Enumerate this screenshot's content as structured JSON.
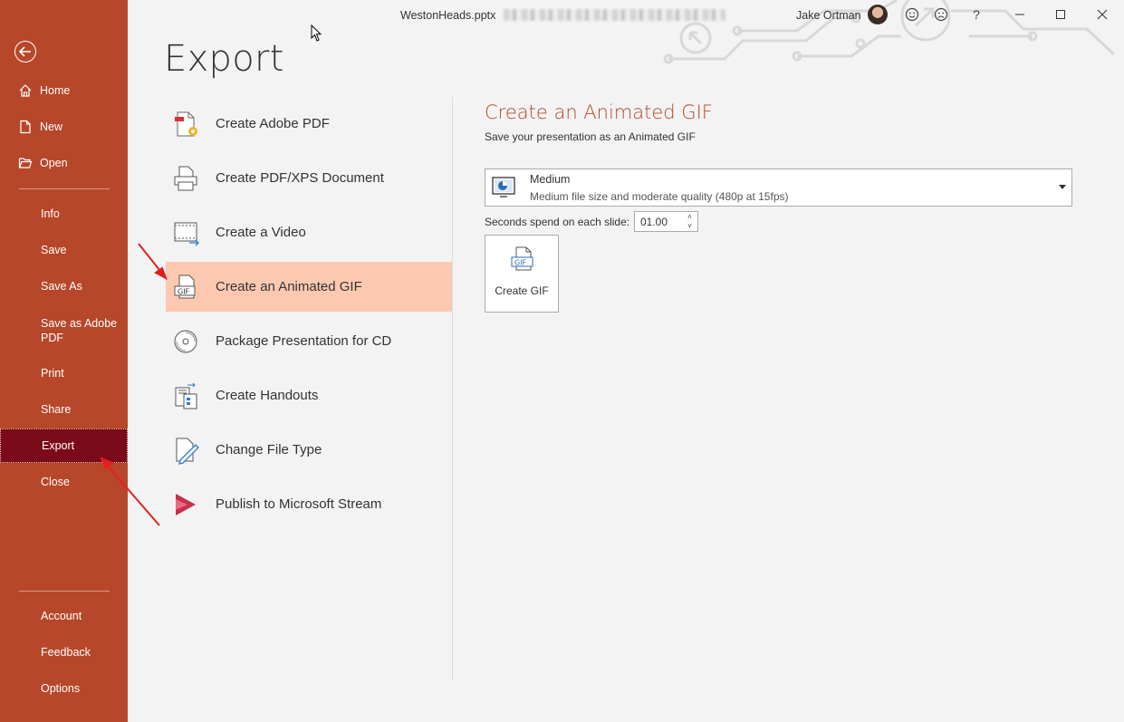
{
  "window": {
    "file_name": "WestonHeads.pptx",
    "user_name": "Jake Ortman",
    "help_label": "?"
  },
  "sidebar": {
    "items": [
      {
        "id": "home",
        "label": "Home",
        "icon": "home-icon"
      },
      {
        "id": "new",
        "label": "New",
        "icon": "new-document-icon"
      },
      {
        "id": "open",
        "label": "Open",
        "icon": "open-folder-icon"
      },
      {
        "id": "info",
        "label": "Info"
      },
      {
        "id": "save",
        "label": "Save"
      },
      {
        "id": "save-as",
        "label": "Save As"
      },
      {
        "id": "save-as-adobe-pdf",
        "label": "Save as Adobe PDF"
      },
      {
        "id": "print",
        "label": "Print"
      },
      {
        "id": "share",
        "label": "Share"
      },
      {
        "id": "export",
        "label": "Export",
        "selected": true
      },
      {
        "id": "close",
        "label": "Close"
      },
      {
        "id": "account",
        "label": "Account"
      },
      {
        "id": "feedback",
        "label": "Feedback"
      },
      {
        "id": "options",
        "label": "Options"
      }
    ],
    "bg_color": "#b7472a",
    "selected_color": "#7b0b18"
  },
  "page": {
    "title": "Export"
  },
  "export_options": [
    {
      "label": "Create Adobe PDF",
      "icon": "adobe-pdf-icon"
    },
    {
      "label": "Create PDF/XPS Document",
      "icon": "pdf-xps-icon"
    },
    {
      "label": "Create a Video",
      "icon": "video-icon"
    },
    {
      "label": "Create an Animated GIF",
      "icon": "gif-icon",
      "selected": true
    },
    {
      "label": "Package Presentation for CD",
      "icon": "cd-icon"
    },
    {
      "label": "Create Handouts",
      "icon": "handouts-icon"
    },
    {
      "label": "Change File Type",
      "icon": "change-file-type-icon"
    },
    {
      "label": "Publish to Microsoft Stream",
      "icon": "stream-icon"
    }
  ],
  "detail": {
    "title": "Create an Animated GIF",
    "subtitle": "Save your presentation as an Animated GIF",
    "quality": {
      "selected": "Medium",
      "description": "Medium file size and moderate quality (480p at 15fps)"
    },
    "seconds": {
      "label": "Seconds spend on each slide:",
      "value": "01.00"
    },
    "create_button_label": "Create GIF"
  },
  "colors": {
    "accent": "#b7472a",
    "selected_option_bg": "#fcc9b0",
    "annotation_arrow": "#e02020"
  }
}
